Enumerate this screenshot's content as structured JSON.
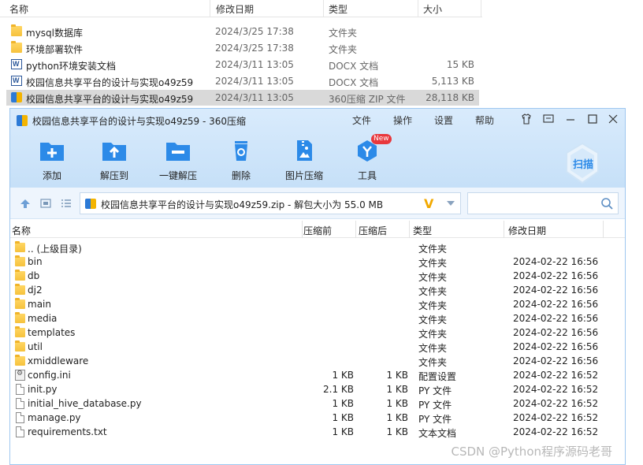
{
  "explorer": {
    "columns": {
      "name": "名称",
      "date": "修改日期",
      "type": "类型",
      "size": "大小"
    },
    "rows": [
      {
        "icon": "folder-icon",
        "name": "mysql数据库",
        "date": "2024/3/25 17:38",
        "type": "文件夹",
        "size": ""
      },
      {
        "icon": "folder-icon",
        "name": "环境部署软件",
        "date": "2024/3/25 17:38",
        "type": "文件夹",
        "size": ""
      },
      {
        "icon": "word-doc-icon",
        "name": "python环境安装文档",
        "date": "2024/3/11 13:05",
        "type": "DOCX 文档",
        "size": "15 KB"
      },
      {
        "icon": "word-doc-icon",
        "name": "校园信息共享平台的设计与实现o49z59",
        "date": "2024/3/11 13:05",
        "type": "DOCX 文档",
        "size": "5,113 KB"
      },
      {
        "icon": "zip-archive-icon",
        "name": "校园信息共享平台的设计与实现o49z59",
        "date": "2024/3/11 13:05",
        "type": "360压缩 ZIP 文件",
        "size": "28,118 KB"
      }
    ]
  },
  "window": {
    "title": "校园信息共享平台的设计与实现o49z59 - 360压缩",
    "menu": {
      "file": "文件",
      "ops": "操作",
      "settings": "设置",
      "help": "帮助"
    },
    "toolbar": {
      "add": "添加",
      "extract_to": "解压到",
      "one_click_extract": "一键解压",
      "delete": "删除",
      "image_compress": "图片压缩",
      "tools": "工具",
      "new_badge": "New",
      "scan": "扫描"
    },
    "address": {
      "path": "校园信息共享平台的设计与实现o49z59.zip - 解包大小为 55.0 MB",
      "v_mark": "V"
    },
    "search": {
      "placeholder": ""
    },
    "list": {
      "columns": {
        "name": "名称",
        "compressed": "压缩前",
        "uncompressed": "压缩后",
        "type": "类型",
        "date": "修改日期"
      },
      "rows": [
        {
          "kind": "folder",
          "name": ".. (上级目录)",
          "before": "",
          "after": "",
          "type": "文件夹",
          "date": ""
        },
        {
          "kind": "folder",
          "name": "bin",
          "before": "",
          "after": "",
          "type": "文件夹",
          "date": "2024-02-22 16:56"
        },
        {
          "kind": "folder",
          "name": "db",
          "before": "",
          "after": "",
          "type": "文件夹",
          "date": "2024-02-22 16:56"
        },
        {
          "kind": "folder",
          "name": "dj2",
          "before": "",
          "after": "",
          "type": "文件夹",
          "date": "2024-02-22 16:56"
        },
        {
          "kind": "folder",
          "name": "main",
          "before": "",
          "after": "",
          "type": "文件夹",
          "date": "2024-02-22 16:56"
        },
        {
          "kind": "folder",
          "name": "media",
          "before": "",
          "after": "",
          "type": "文件夹",
          "date": "2024-02-22 16:56"
        },
        {
          "kind": "folder",
          "name": "templates",
          "before": "",
          "after": "",
          "type": "文件夹",
          "date": "2024-02-22 16:56"
        },
        {
          "kind": "folder",
          "name": "util",
          "before": "",
          "after": "",
          "type": "文件夹",
          "date": "2024-02-22 16:56"
        },
        {
          "kind": "folder",
          "name": "xmiddleware",
          "before": "",
          "after": "",
          "type": "文件夹",
          "date": "2024-02-22 16:56"
        },
        {
          "kind": "config",
          "name": "config.ini",
          "before": "1 KB",
          "after": "1 KB",
          "type": "配置设置",
          "date": "2024-02-22 16:52"
        },
        {
          "kind": "file",
          "name": "init.py",
          "before": "2.1 KB",
          "after": "1 KB",
          "type": "PY 文件",
          "date": "2024-02-22 16:52"
        },
        {
          "kind": "file",
          "name": "initial_hive_database.py",
          "before": "1 KB",
          "after": "1 KB",
          "type": "PY 文件",
          "date": "2024-02-22 16:52"
        },
        {
          "kind": "file",
          "name": "manage.py",
          "before": "1 KB",
          "after": "1 KB",
          "type": "PY 文件",
          "date": "2024-02-22 16:52"
        },
        {
          "kind": "file",
          "name": "requirements.txt",
          "before": "1 KB",
          "after": "1 KB",
          "type": "文本文档",
          "date": "2024-02-22 16:52"
        }
      ]
    }
  },
  "watermark": "CSDN @Python程序源码老哥",
  "colors": {
    "accent_blue": "#2c8ae8",
    "titlebar": "#d4e8fb",
    "v_mark": "#f2a900",
    "new_badge": "#e8383d"
  }
}
